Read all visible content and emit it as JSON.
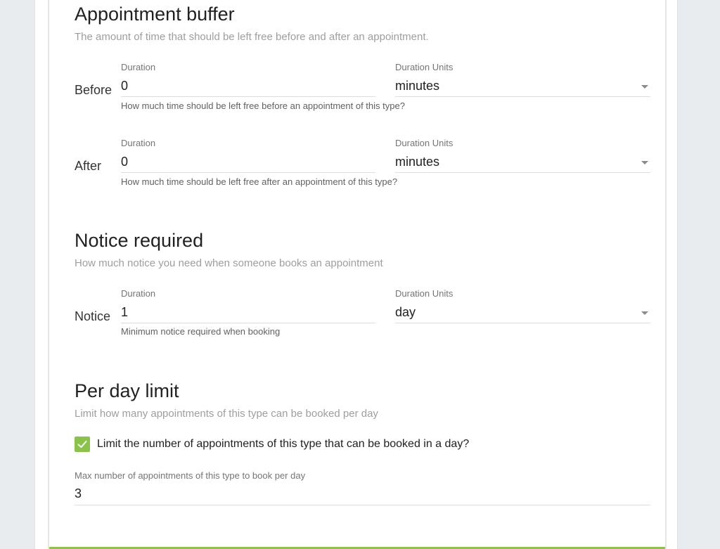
{
  "sections": {
    "buffer": {
      "title": "Appointment buffer",
      "subtitle": "The amount of time that should be left free before and after an appointment.",
      "rows": [
        {
          "label": "Before",
          "duration_label": "Duration",
          "duration_value": "0",
          "units_label": "Duration Units",
          "units_value": "minutes",
          "hint": "How much time should be left free before an appointment of this type?"
        },
        {
          "label": "After",
          "duration_label": "Duration",
          "duration_value": "0",
          "units_label": "Duration Units",
          "units_value": "minutes",
          "hint": "How much time should be left free after an appointment of this type?"
        }
      ]
    },
    "notice": {
      "title": "Notice required",
      "subtitle": "How much notice you need when someone books an appointment",
      "row": {
        "label": "Notice",
        "duration_label": "Duration",
        "duration_value": "1",
        "units_label": "Duration Units",
        "units_value": "day",
        "hint": "Minimum notice required when booking"
      }
    },
    "per_day": {
      "title": "Per day limit",
      "subtitle": "Limit how many appointments of this type can be booked per day",
      "checkbox_label": "Limit the number of appointments of this type that can be booked in a day?",
      "checkbox_checked": true,
      "max_label": "Max number of appointments of this type to book per day",
      "max_value": "3"
    }
  },
  "colors": {
    "accent": "#8bc34a",
    "background": "#e9ecef"
  }
}
